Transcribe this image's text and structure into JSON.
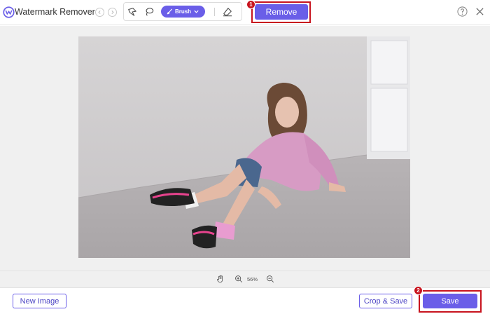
{
  "app": {
    "title": "Watermark Remover"
  },
  "toolbar": {
    "brush_label": "Brush"
  },
  "actions": {
    "remove_label": "Remove",
    "save_label": "Save",
    "crop_save_label": "Crop & Save",
    "new_image_label": "New Image"
  },
  "markers": {
    "first": "1",
    "second": "2"
  },
  "zoom": {
    "level": "56%"
  },
  "colors": {
    "accent": "#6a5ee8",
    "highlight": "#c8141e",
    "canvas_bg": "#f0f0f0"
  },
  "icons": {
    "logo": "watermark-logo-icon",
    "undo": "undo-icon",
    "redo": "redo-icon",
    "polygon": "polygonal-lasso-icon",
    "lasso": "lasso-icon",
    "brush": "brush-icon",
    "eraser": "eraser-icon",
    "help": "help-icon",
    "close": "close-icon",
    "hand": "hand-pan-icon",
    "zoom_in": "zoom-in-icon",
    "zoom_out": "zoom-out-icon"
  }
}
